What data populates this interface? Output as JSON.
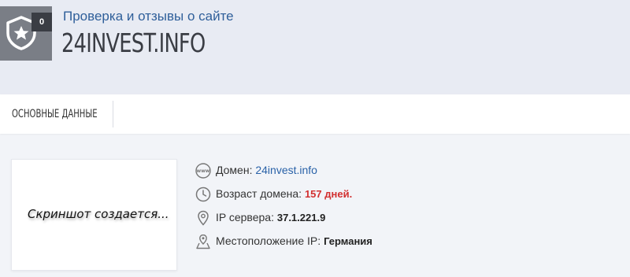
{
  "header": {
    "subtitle": "Проверка и отзывы о сайте",
    "site_name": "24INVEST.INFO",
    "review_count": "0",
    "badge_icon": "shield-star-icon"
  },
  "tabs": [
    {
      "label": "ОСНОВНЫЕ ДАННЫЕ"
    }
  ],
  "screenshot": {
    "placeholder": "Скриншот создается..."
  },
  "info": {
    "domain": {
      "label": "Домен:",
      "value": "24invest.info",
      "icon": "www-icon"
    },
    "domain_age": {
      "label": "Возраст домена:",
      "value": "157 дней.",
      "icon": "clock-icon"
    },
    "server_ip": {
      "label": "IP сервера:",
      "value": "37.1.221.9",
      "icon": "map-pin-icon"
    },
    "ip_location": {
      "label": "Местоположение IP:",
      "value": "Германия",
      "icon": "map-location-icon"
    }
  },
  "colors": {
    "accent": "#2f5f9a",
    "link": "#2a62a8",
    "danger": "#d23030",
    "header_bg": "#e8ebf3"
  }
}
